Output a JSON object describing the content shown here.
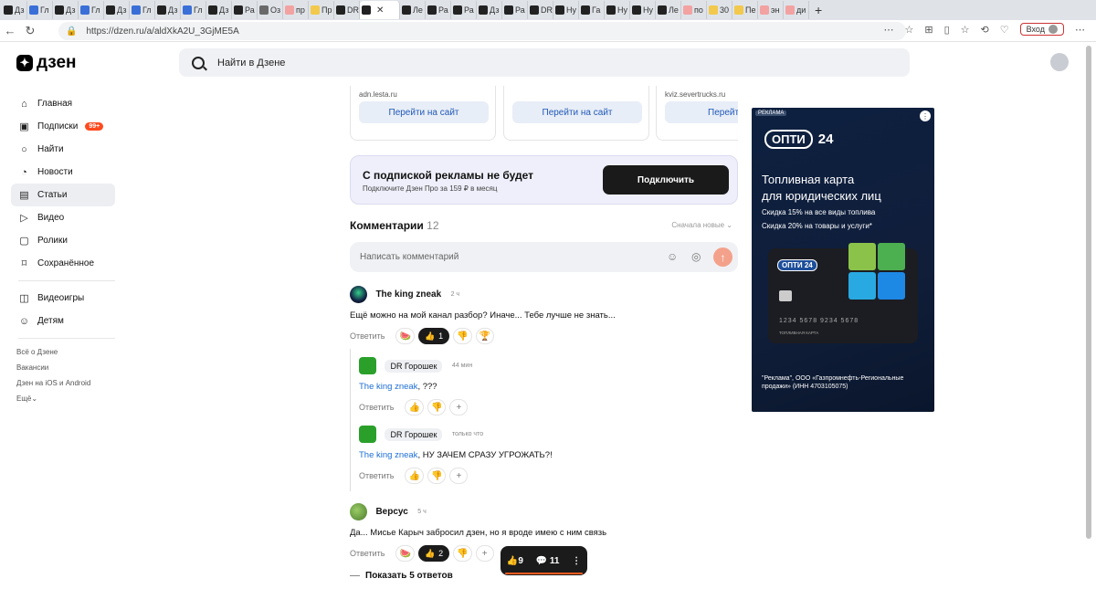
{
  "browser": {
    "tabs": [
      {
        "label": "Дз",
        "fav": "dark"
      },
      {
        "label": "Гл",
        "fav": "blue"
      },
      {
        "label": "Дз",
        "fav": "dark"
      },
      {
        "label": "Гл",
        "fav": "blue"
      },
      {
        "label": "Дз",
        "fav": "dark"
      },
      {
        "label": "Гл",
        "fav": "blue"
      },
      {
        "label": "Дз",
        "fav": "dark"
      },
      {
        "label": "Гл",
        "fav": "blue"
      },
      {
        "label": "Дз",
        "fav": "dark"
      },
      {
        "label": "Ра",
        "fav": "dark"
      },
      {
        "label": "Оз",
        "fav": "grey"
      },
      {
        "label": "пр",
        "fav": "pink"
      },
      {
        "label": "Пр",
        "fav": "yellow"
      },
      {
        "label": "DR",
        "fav": "dark"
      },
      {
        "label": "",
        "fav": "dark",
        "active": true
      },
      {
        "label": "Ле",
        "fav": "dark"
      },
      {
        "label": "Ра",
        "fav": "dark"
      },
      {
        "label": "Ра",
        "fav": "dark"
      },
      {
        "label": "Дз",
        "fav": "dark"
      },
      {
        "label": "Ра",
        "fav": "dark"
      },
      {
        "label": "DR",
        "fav": "dark"
      },
      {
        "label": "Ну",
        "fav": "dark"
      },
      {
        "label": "Га",
        "fav": "dark"
      },
      {
        "label": "Ну",
        "fav": "dark"
      },
      {
        "label": "Ну",
        "fav": "dark"
      },
      {
        "label": "Ле",
        "fav": "dark"
      },
      {
        "label": "по",
        "fav": "pink"
      },
      {
        "label": "30",
        "fav": "yellow"
      },
      {
        "label": "Пе",
        "fav": "yellow"
      },
      {
        "label": "эн",
        "fav": "pink"
      },
      {
        "label": "ди",
        "fav": "pink"
      }
    ],
    "url": "https://dzen.ru/a/aldXkA2U_3GjME5A",
    "login_label": "Вход"
  },
  "header": {
    "logo_text": "дзен",
    "search_placeholder": "Найти в Дзене"
  },
  "sidebar": {
    "items": [
      {
        "label": "Главная",
        "icon": "home-icon",
        "glyph": "⌂"
      },
      {
        "label": "Подписки",
        "icon": "subscriptions-icon",
        "glyph": "▣",
        "badge": "99+"
      },
      {
        "label": "Найти",
        "icon": "search-icon",
        "glyph": "○"
      },
      {
        "label": "Новости",
        "icon": "news-icon",
        "glyph": "◔"
      },
      {
        "label": "Статьи",
        "icon": "articles-icon",
        "glyph": "▤",
        "active": true
      },
      {
        "label": "Видео",
        "icon": "video-icon",
        "glyph": "▷"
      },
      {
        "label": "Ролики",
        "icon": "shorts-icon",
        "glyph": "▢"
      },
      {
        "label": "Сохранённое",
        "icon": "bookmark-icon",
        "glyph": "⌑"
      }
    ],
    "items2": [
      {
        "label": "Видеоигры",
        "icon": "gamepad-icon",
        "glyph": "◫"
      },
      {
        "label": "Детям",
        "icon": "kids-icon",
        "glyph": "☺"
      }
    ],
    "footer": [
      "Всё о Дзене",
      "Вакансии",
      "Дзен на iOS и Android",
      "Ещё"
    ]
  },
  "ad_cards": [
    {
      "domain": "adn.lesta.ru",
      "button": "Перейти на сайт"
    },
    {
      "domain": "",
      "button": "Перейти на сайт"
    },
    {
      "domain": "kviz.severtrucks.ru",
      "button": "Перейти н"
    }
  ],
  "promo": {
    "title": "С подпиской рекламы не будет",
    "subtitle": "Подключите Дзен Про за 159 ₽ в месяц",
    "button": "Подключить"
  },
  "comments_section": {
    "title": "Комментарии",
    "count": "12",
    "sort": "Сначала новые",
    "input_placeholder": "Написать комментарий"
  },
  "comments": [
    {
      "author": "The king zneak",
      "time": "2 ч",
      "text": "Ещё можно на мой канал разбор? Иначе... Тебе лучше не знать...",
      "reply": "Ответить",
      "likes": "1"
    },
    {
      "author": "DR Горошек",
      "time": "44 мин",
      "ref": "The king zneak",
      "text": ", ???",
      "reply": "Ответить"
    },
    {
      "author": "DR Горошек",
      "time": "только что",
      "ref": "The king zneak",
      "text": ", НУ ЗАЧЕМ СРАЗУ УГРОЖАТЬ?!",
      "reply": "Ответить"
    },
    {
      "author": "Версус",
      "time": "5 ч",
      "text": "Да... Мисье Карыч забросил дзен, но я вроде имею с ним связь",
      "reply": "Ответить",
      "likes": "2"
    }
  ],
  "show_more": "Показать 5 ответов",
  "bottom_bar": {
    "likes": "9",
    "comments": "11"
  },
  "side_ad": {
    "label": "РЕКЛАМА",
    "brand": "ОПТИ",
    "brand_num": "24",
    "headline1": "Топливная карта",
    "headline2": "для юридических лиц",
    "line1": "Скидка 15% на все виды топлива",
    "line2": "Скидка 20% на товары и услуги*",
    "card_brand": "ОПТИ 24",
    "card_number": "1234  5678  9234  5678",
    "card_label": "ТОПЛИВНАЯ КАРТА",
    "disclaimer": "\"Реклама\", ООО «Газпромнефть-Региональные продажи» (ИНН 4703105075)"
  }
}
